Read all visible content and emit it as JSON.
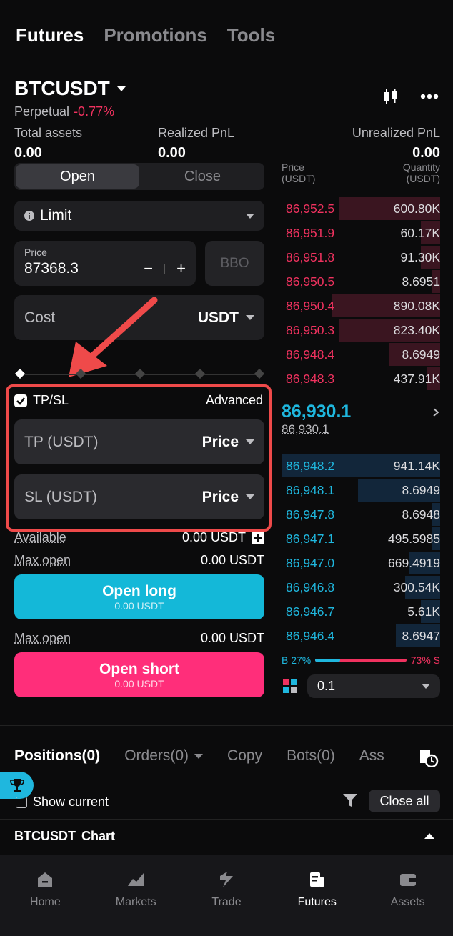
{
  "nav": {
    "tabs": [
      "Futures",
      "Promotions",
      "Tools"
    ]
  },
  "symbol": {
    "name": "BTCUSDT",
    "type": "Perpetual",
    "change": "-0.77%"
  },
  "stats": {
    "total_label": "Total assets",
    "total_val": "0.00",
    "realized_label": "Realized PnL",
    "realized_val": "0.00",
    "unrealized_label": "Unrealized PnL",
    "unrealized_val": "0.00"
  },
  "form": {
    "open": "Open",
    "close": "Close",
    "order_type": "Limit",
    "price_label": "Price",
    "price_val": "87368.3",
    "minus": "−",
    "plus": "+",
    "bbo": "BBO",
    "cost": "Cost",
    "cost_unit": "USDT",
    "tpsl": "TP/SL",
    "advanced": "Advanced",
    "tp": "TP (USDT)",
    "sl": "SL (USDT)",
    "price_mode": "Price",
    "available_label": "Available",
    "available_val": "0.00 USDT",
    "maxopen_label": "Max open",
    "maxopen_val": "0.00 USDT",
    "open_long": "Open long",
    "open_long_sub": "0.00 USDT",
    "maxopen2_label": "Max open",
    "maxopen2_val": "0.00 USDT",
    "open_short": "Open short",
    "open_short_sub": "0.00 USDT"
  },
  "orderbook": {
    "price_head": "Price",
    "price_unit": "(USDT)",
    "qty_head": "Quantity",
    "qty_unit": "(USDT)",
    "asks": [
      {
        "p": "86,952.5",
        "q": "600.80K"
      },
      {
        "p": "86,951.9",
        "q": "60.17K"
      },
      {
        "p": "86,951.8",
        "q": "91.30K"
      },
      {
        "p": "86,950.5",
        "q": "8.6951"
      },
      {
        "p": "86,950.4",
        "q": "890.08K"
      },
      {
        "p": "86,950.3",
        "q": "823.40K"
      },
      {
        "p": "86,948.4",
        "q": "8.6949"
      },
      {
        "p": "86,948.3",
        "q": "437.91K"
      }
    ],
    "last": "86,930.1",
    "mark": "86,930.1",
    "bids": [
      {
        "p": "86,948.2",
        "q": "941.14K"
      },
      {
        "p": "86,948.1",
        "q": "8.6949"
      },
      {
        "p": "86,947.8",
        "q": "8.6948"
      },
      {
        "p": "86,947.1",
        "q": "495.5985"
      },
      {
        "p": "86,947.0",
        "q": "669.4919"
      },
      {
        "p": "86,946.8",
        "q": "300.54K"
      },
      {
        "p": "86,946.7",
        "q": "5.61K"
      },
      {
        "p": "86,946.4",
        "q": "8.6947"
      }
    ],
    "buy_pct": "B 27%",
    "sell_pct": "73% S",
    "step": "0.1",
    "buy_ratio": 0.27
  },
  "positions": {
    "tabs": [
      "Positions(0)",
      "Orders(0)",
      "Copy",
      "Bots(0)",
      "Ass"
    ],
    "show_current": "Show current",
    "close_all": "Close all",
    "chart_sym": "BTCUSDT",
    "chart_label": "Chart"
  },
  "bottom": [
    "Home",
    "Markets",
    "Trade",
    "Futures",
    "Assets"
  ],
  "colors": {
    "accent_red": "#f0325f",
    "accent_blue": "#1fb7de",
    "long": "#14b8d8",
    "short": "#ff2e7a",
    "highlight": "#ef4a4a"
  }
}
